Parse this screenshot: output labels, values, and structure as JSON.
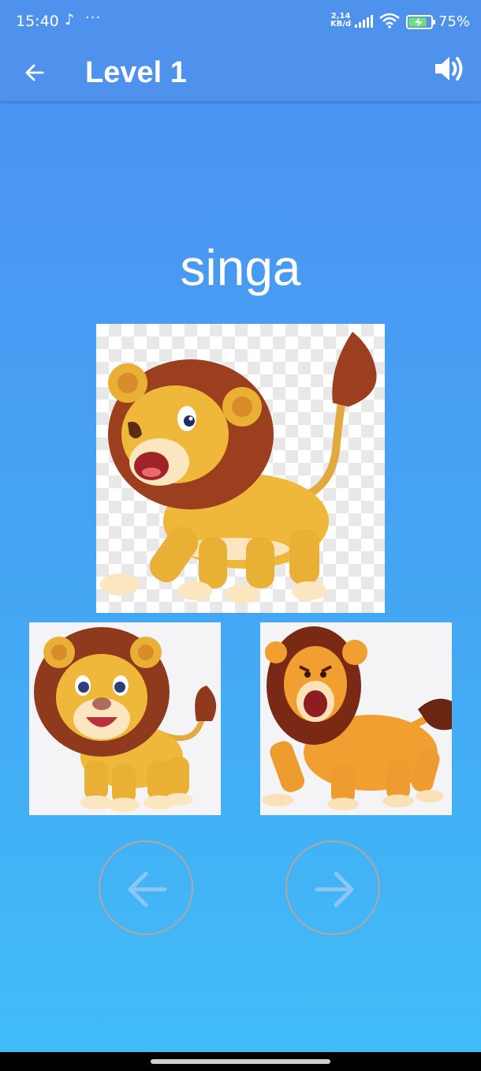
{
  "status_bar": {
    "time": "15:40",
    "network_speed_value": "2,14",
    "network_speed_unit": "KB/d",
    "battery_percent": "75%",
    "icons": [
      "tiktok-icon",
      "more-dots-icon",
      "signal-icon",
      "wifi-icon",
      "battery-charging-icon"
    ]
  },
  "app_bar": {
    "title": "Level 1",
    "back_icon": "arrow-left-icon",
    "sound_icon": "speaker-icon"
  },
  "word": "singa",
  "images": [
    {
      "role": "main",
      "subject": "cartoon lion walking"
    },
    {
      "role": "option-left",
      "subject": "cartoon lion cub smiling"
    },
    {
      "role": "option-right",
      "subject": "cartoon lion roaring"
    }
  ],
  "navigation": {
    "prev_icon": "arrow-left-icon",
    "next_icon": "arrow-right-icon"
  },
  "colors": {
    "app_bar": "#4f92ee",
    "background_top": "#4c8ff2",
    "background_bottom": "#40bdf7",
    "nav_ring": "#b3a6a0",
    "nav_arrow": "#8cc6f6"
  }
}
